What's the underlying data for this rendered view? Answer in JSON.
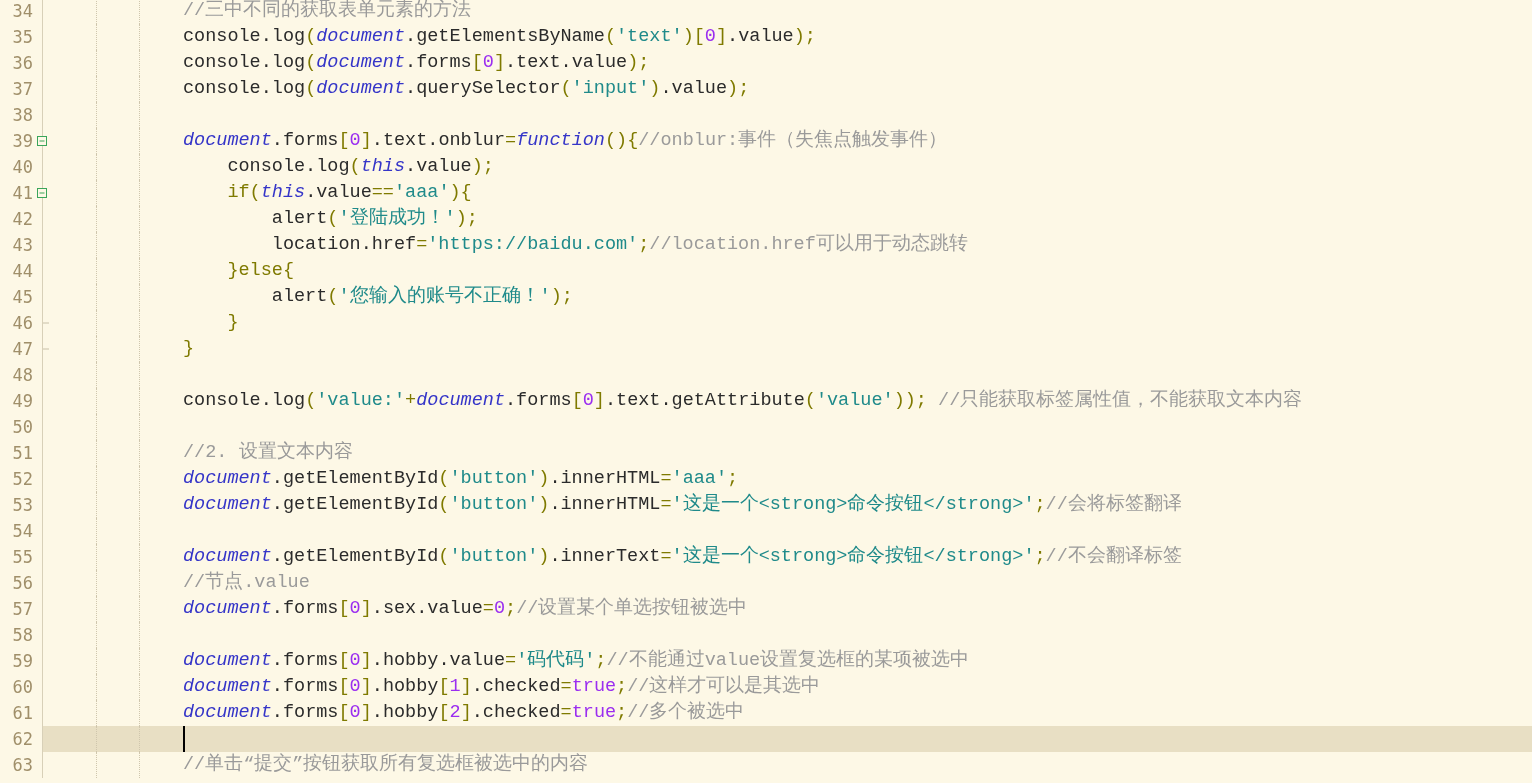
{
  "editor": {
    "lines": [
      {
        "number": "34",
        "tokens": [
          {
            "kind": "comment",
            "text": "//三中不同的获取表单元素的方法"
          }
        ]
      },
      {
        "number": "35",
        "tokens": [
          {
            "kind": "plain",
            "text": "console.log"
          },
          {
            "kind": "punct",
            "text": "("
          },
          {
            "kind": "object",
            "text": "document"
          },
          {
            "kind": "plain",
            "text": ".getElementsByName"
          },
          {
            "kind": "punct",
            "text": "("
          },
          {
            "kind": "string",
            "text": "'text'"
          },
          {
            "kind": "punct",
            "text": ")["
          },
          {
            "kind": "number",
            "text": "0"
          },
          {
            "kind": "punct",
            "text": "]"
          },
          {
            "kind": "plain",
            "text": ".value"
          },
          {
            "kind": "punct",
            "text": ");"
          }
        ]
      },
      {
        "number": "36",
        "tokens": [
          {
            "kind": "plain",
            "text": "console.log"
          },
          {
            "kind": "punct",
            "text": "("
          },
          {
            "kind": "object",
            "text": "document"
          },
          {
            "kind": "plain",
            "text": ".forms"
          },
          {
            "kind": "punct",
            "text": "["
          },
          {
            "kind": "number",
            "text": "0"
          },
          {
            "kind": "punct",
            "text": "]"
          },
          {
            "kind": "plain",
            "text": ".text.value"
          },
          {
            "kind": "punct",
            "text": ");"
          }
        ]
      },
      {
        "number": "37",
        "tokens": [
          {
            "kind": "plain",
            "text": "console.log"
          },
          {
            "kind": "punct",
            "text": "("
          },
          {
            "kind": "object",
            "text": "document"
          },
          {
            "kind": "plain",
            "text": ".querySelector"
          },
          {
            "kind": "punct",
            "text": "("
          },
          {
            "kind": "string",
            "text": "'input'"
          },
          {
            "kind": "punct",
            "text": ")"
          },
          {
            "kind": "plain",
            "text": ".value"
          },
          {
            "kind": "punct",
            "text": ");"
          }
        ]
      },
      {
        "number": "38"
      },
      {
        "number": "39",
        "fold_start": true,
        "tokens": [
          {
            "kind": "object",
            "text": "document"
          },
          {
            "kind": "plain",
            "text": ".forms"
          },
          {
            "kind": "punct",
            "text": "["
          },
          {
            "kind": "number",
            "text": "0"
          },
          {
            "kind": "punct",
            "text": "]"
          },
          {
            "kind": "plain",
            "text": ".text.onblur"
          },
          {
            "kind": "punct",
            "text": "="
          },
          {
            "kind": "object",
            "text": "function"
          },
          {
            "kind": "punct",
            "text": "(){"
          },
          {
            "kind": "comment",
            "text": "//onblur:事件（失焦点触发事件）"
          }
        ]
      },
      {
        "number": "40",
        "tokens": [
          {
            "kind": "plain",
            "text": "    console.log"
          },
          {
            "kind": "punct",
            "text": "("
          },
          {
            "kind": "object",
            "text": "this"
          },
          {
            "kind": "plain",
            "text": ".value"
          },
          {
            "kind": "punct",
            "text": ");"
          }
        ]
      },
      {
        "number": "41",
        "fold_start": true,
        "tokens": [
          {
            "kind": "punct",
            "text": "    if("
          },
          {
            "kind": "object",
            "text": "this"
          },
          {
            "kind": "plain",
            "text": ".value"
          },
          {
            "kind": "punct",
            "text": "=="
          },
          {
            "kind": "string",
            "text": "'aaa'"
          },
          {
            "kind": "punct",
            "text": "){"
          }
        ]
      },
      {
        "number": "42",
        "tokens": [
          {
            "kind": "plain",
            "text": "        alert"
          },
          {
            "kind": "punct",
            "text": "("
          },
          {
            "kind": "string",
            "text": "'登陆成功！'"
          },
          {
            "kind": "punct",
            "text": ");"
          }
        ]
      },
      {
        "number": "43",
        "tokens": [
          {
            "kind": "plain",
            "text": "        location.href"
          },
          {
            "kind": "punct",
            "text": "="
          },
          {
            "kind": "string",
            "text": "'https://baidu.com'"
          },
          {
            "kind": "punct",
            "text": ";"
          },
          {
            "kind": "comment",
            "text": "//location.href可以用于动态跳转"
          }
        ]
      },
      {
        "number": "44",
        "tokens": [
          {
            "kind": "punct",
            "text": "    }else{"
          }
        ]
      },
      {
        "number": "45",
        "tokens": [
          {
            "kind": "plain",
            "text": "        alert"
          },
          {
            "kind": "punct",
            "text": "("
          },
          {
            "kind": "string",
            "text": "'您输入的账号不正确！'"
          },
          {
            "kind": "punct",
            "text": ");"
          }
        ]
      },
      {
        "number": "46",
        "fold_end": true,
        "tokens": [
          {
            "kind": "punct",
            "text": "    }"
          }
        ]
      },
      {
        "number": "47",
        "fold_end": true,
        "tokens": [
          {
            "kind": "punct",
            "text": "}"
          }
        ]
      },
      {
        "number": "48"
      },
      {
        "number": "49",
        "tokens": [
          {
            "kind": "plain",
            "text": "console.log"
          },
          {
            "kind": "punct",
            "text": "("
          },
          {
            "kind": "string",
            "text": "'value:'"
          },
          {
            "kind": "punct",
            "text": "+"
          },
          {
            "kind": "object",
            "text": "document"
          },
          {
            "kind": "plain",
            "text": ".forms"
          },
          {
            "kind": "punct",
            "text": "["
          },
          {
            "kind": "number",
            "text": "0"
          },
          {
            "kind": "punct",
            "text": "]"
          },
          {
            "kind": "plain",
            "text": ".text.getAttribute"
          },
          {
            "kind": "punct",
            "text": "("
          },
          {
            "kind": "string",
            "text": "'value'"
          },
          {
            "kind": "punct",
            "text": ")); "
          },
          {
            "kind": "comment",
            "text": "//只能获取标签属性值，不能获取文本内容"
          }
        ]
      },
      {
        "number": "50"
      },
      {
        "number": "51",
        "tokens": [
          {
            "kind": "comment",
            "text": "//2. 设置文本内容"
          }
        ]
      },
      {
        "number": "52",
        "tokens": [
          {
            "kind": "object",
            "text": "document"
          },
          {
            "kind": "plain",
            "text": ".getElementById"
          },
          {
            "kind": "punct",
            "text": "("
          },
          {
            "kind": "string",
            "text": "'button'"
          },
          {
            "kind": "punct",
            "text": ")"
          },
          {
            "kind": "plain",
            "text": ".innerHTML"
          },
          {
            "kind": "punct",
            "text": "="
          },
          {
            "kind": "string",
            "text": "'aaa'"
          },
          {
            "kind": "punct",
            "text": ";"
          }
        ]
      },
      {
        "number": "53",
        "tokens": [
          {
            "kind": "object",
            "text": "document"
          },
          {
            "kind": "plain",
            "text": ".getElementById"
          },
          {
            "kind": "punct",
            "text": "("
          },
          {
            "kind": "string",
            "text": "'button'"
          },
          {
            "kind": "punct",
            "text": ")"
          },
          {
            "kind": "plain",
            "text": ".innerHTML"
          },
          {
            "kind": "punct",
            "text": "="
          },
          {
            "kind": "string",
            "text": "'这是一个<strong>命令按钮</strong>'"
          },
          {
            "kind": "punct",
            "text": ";"
          },
          {
            "kind": "comment",
            "text": "//会将标签翻译"
          }
        ]
      },
      {
        "number": "54"
      },
      {
        "number": "55",
        "tokens": [
          {
            "kind": "object",
            "text": "document"
          },
          {
            "kind": "plain",
            "text": ".getElementById"
          },
          {
            "kind": "punct",
            "text": "("
          },
          {
            "kind": "string",
            "text": "'button'"
          },
          {
            "kind": "punct",
            "text": ")"
          },
          {
            "kind": "plain",
            "text": ".innerText"
          },
          {
            "kind": "punct",
            "text": "="
          },
          {
            "kind": "string",
            "text": "'这是一个<strong>命令按钮</strong>'"
          },
          {
            "kind": "punct",
            "text": ";"
          },
          {
            "kind": "comment",
            "text": "//不会翻译标签"
          }
        ]
      },
      {
        "number": "56",
        "tokens": [
          {
            "kind": "comment",
            "text": "//节点.value"
          }
        ]
      },
      {
        "number": "57",
        "tokens": [
          {
            "kind": "object",
            "text": "document"
          },
          {
            "kind": "plain",
            "text": ".forms"
          },
          {
            "kind": "punct",
            "text": "["
          },
          {
            "kind": "number",
            "text": "0"
          },
          {
            "kind": "punct",
            "text": "]"
          },
          {
            "kind": "plain",
            "text": ".sex.value"
          },
          {
            "kind": "punct",
            "text": "="
          },
          {
            "kind": "number",
            "text": "0"
          },
          {
            "kind": "punct",
            "text": ";"
          },
          {
            "kind": "comment",
            "text": "//设置某个单选按钮被选中"
          }
        ]
      },
      {
        "number": "58"
      },
      {
        "number": "59",
        "tokens": [
          {
            "kind": "object",
            "text": "document"
          },
          {
            "kind": "plain",
            "text": ".forms"
          },
          {
            "kind": "punct",
            "text": "["
          },
          {
            "kind": "number",
            "text": "0"
          },
          {
            "kind": "punct",
            "text": "]"
          },
          {
            "kind": "plain",
            "text": ".hobby.value"
          },
          {
            "kind": "punct",
            "text": "="
          },
          {
            "kind": "string",
            "text": "'码代码'"
          },
          {
            "kind": "punct",
            "text": ";"
          },
          {
            "kind": "comment",
            "text": "//不能通过value设置复选框的某项被选中"
          }
        ]
      },
      {
        "number": "60",
        "tokens": [
          {
            "kind": "object",
            "text": "document"
          },
          {
            "kind": "plain",
            "text": ".forms"
          },
          {
            "kind": "punct",
            "text": "["
          },
          {
            "kind": "number",
            "text": "0"
          },
          {
            "kind": "punct",
            "text": "]"
          },
          {
            "kind": "plain",
            "text": ".hobby"
          },
          {
            "kind": "punct",
            "text": "["
          },
          {
            "kind": "number",
            "text": "1"
          },
          {
            "kind": "punct",
            "text": "]"
          },
          {
            "kind": "plain",
            "text": ".checked"
          },
          {
            "kind": "punct",
            "text": "="
          },
          {
            "kind": "number",
            "text": "true"
          },
          {
            "kind": "punct",
            "text": ";"
          },
          {
            "kind": "comment",
            "text": "//这样才可以是其选中"
          }
        ]
      },
      {
        "number": "61",
        "tokens": [
          {
            "kind": "object",
            "text": "document"
          },
          {
            "kind": "plain",
            "text": ".forms"
          },
          {
            "kind": "punct",
            "text": "["
          },
          {
            "kind": "number",
            "text": "0"
          },
          {
            "kind": "punct",
            "text": "]"
          },
          {
            "kind": "plain",
            "text": ".hobby"
          },
          {
            "kind": "punct",
            "text": "["
          },
          {
            "kind": "number",
            "text": "2"
          },
          {
            "kind": "punct",
            "text": "]"
          },
          {
            "kind": "plain",
            "text": ".checked"
          },
          {
            "kind": "punct",
            "text": "="
          },
          {
            "kind": "number",
            "text": "true"
          },
          {
            "kind": "punct",
            "text": ";"
          },
          {
            "kind": "comment",
            "text": "//多个被选中"
          }
        ]
      },
      {
        "number": "62",
        "current": true
      },
      {
        "number": "63",
        "tokens": [
          {
            "kind": "comment",
            "text": "//单击“提交”按钮获取所有复选框被选中的内容"
          }
        ]
      }
    ]
  }
}
